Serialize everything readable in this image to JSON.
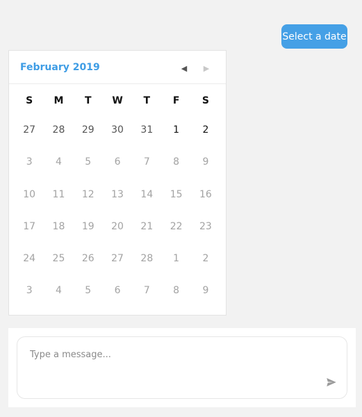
{
  "header": {
    "select_date_label": "Select a date"
  },
  "calendar": {
    "month_title": "February 2019",
    "weekdays": [
      "S",
      "M",
      "T",
      "W",
      "T",
      "F",
      "S"
    ],
    "weeks": [
      [
        {
          "d": "27",
          "tone": "dim1"
        },
        {
          "d": "28",
          "tone": "dim1"
        },
        {
          "d": "29",
          "tone": "dim1"
        },
        {
          "d": "30",
          "tone": "dim1"
        },
        {
          "d": "31",
          "tone": "dim1"
        },
        {
          "d": "1",
          "tone": "strong"
        },
        {
          "d": "2",
          "tone": "strong"
        }
      ],
      [
        {
          "d": "3"
        },
        {
          "d": "4"
        },
        {
          "d": "5"
        },
        {
          "d": "6"
        },
        {
          "d": "7"
        },
        {
          "d": "8"
        },
        {
          "d": "9"
        }
      ],
      [
        {
          "d": "10"
        },
        {
          "d": "11"
        },
        {
          "d": "12"
        },
        {
          "d": "13"
        },
        {
          "d": "14"
        },
        {
          "d": "15"
        },
        {
          "d": "16"
        }
      ],
      [
        {
          "d": "17"
        },
        {
          "d": "18"
        },
        {
          "d": "19"
        },
        {
          "d": "20"
        },
        {
          "d": "21"
        },
        {
          "d": "22"
        },
        {
          "d": "23"
        }
      ],
      [
        {
          "d": "24"
        },
        {
          "d": "25"
        },
        {
          "d": "26"
        },
        {
          "d": "27"
        },
        {
          "d": "28"
        },
        {
          "d": "1"
        },
        {
          "d": "2"
        }
      ],
      [
        {
          "d": "3"
        },
        {
          "d": "4"
        },
        {
          "d": "5"
        },
        {
          "d": "6"
        },
        {
          "d": "7"
        },
        {
          "d": "8"
        },
        {
          "d": "9"
        }
      ]
    ],
    "prev_icon": "triangle-left-icon",
    "next_icon": "triangle-right-icon"
  },
  "composer": {
    "placeholder": "Type a message...",
    "value": "",
    "send_icon": "paper-plane-icon"
  },
  "colors": {
    "accent": "#45a0e6",
    "month_title": "#3f9de5",
    "background": "#f2f2f2"
  }
}
